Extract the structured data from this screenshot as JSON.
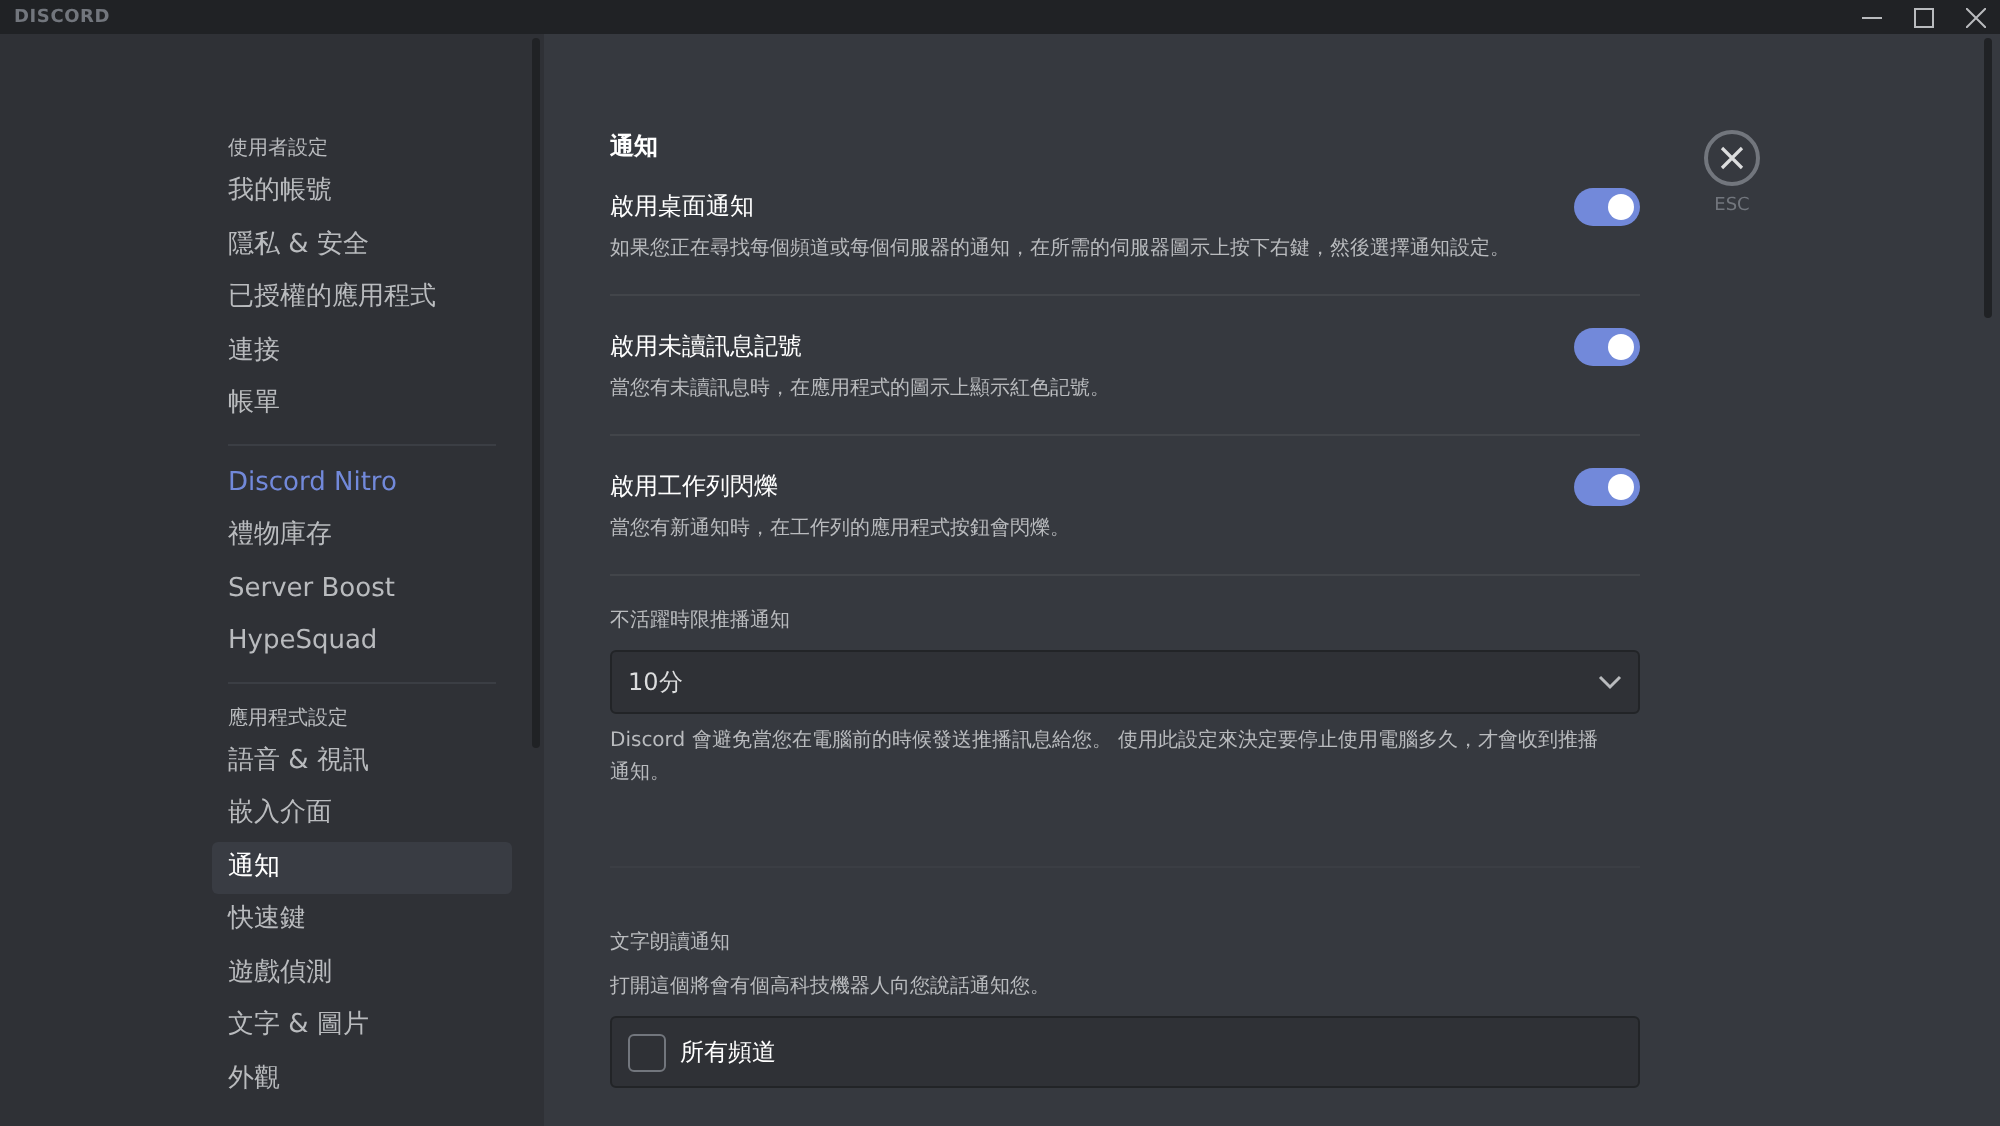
{
  "title_bar": {
    "logo": "DISCORD"
  },
  "sidebar": {
    "sections": [
      {
        "header": "使用者設定",
        "items": [
          {
            "label": "我的帳號",
            "selected": false,
            "kind": "normal"
          },
          {
            "label": "隱私 & 安全",
            "selected": false,
            "kind": "normal"
          },
          {
            "label": "已授權的應用程式",
            "selected": false,
            "kind": "normal"
          },
          {
            "label": "連接",
            "selected": false,
            "kind": "normal"
          },
          {
            "label": "帳單",
            "selected": false,
            "kind": "normal"
          }
        ]
      },
      {
        "items": [
          {
            "label": "Discord Nitro",
            "selected": false,
            "kind": "accent"
          },
          {
            "label": "禮物庫存",
            "selected": false,
            "kind": "normal"
          },
          {
            "label": "Server Boost",
            "selected": false,
            "kind": "normal"
          },
          {
            "label": "HypeSquad",
            "selected": false,
            "kind": "normal"
          }
        ]
      },
      {
        "header": "應用程式設定",
        "items": [
          {
            "label": "語音 & 視訊",
            "selected": false,
            "kind": "normal"
          },
          {
            "label": "嵌入介面",
            "selected": false,
            "kind": "normal"
          },
          {
            "label": "通知",
            "selected": true,
            "kind": "normal"
          },
          {
            "label": "快速鍵",
            "selected": false,
            "kind": "normal"
          },
          {
            "label": "遊戲偵測",
            "selected": false,
            "kind": "normal"
          },
          {
            "label": "文字 & 圖片",
            "selected": false,
            "kind": "normal"
          },
          {
            "label": "外觀",
            "selected": false,
            "kind": "normal"
          }
        ]
      }
    ]
  },
  "content": {
    "title": "通知",
    "toggles": [
      {
        "label": "啟用桌面通知",
        "description": "如果您正在尋找每個頻道或每個伺服器的通知，在所需的伺服器圖示上按下右鍵，然後選擇通知設定。",
        "on": true
      },
      {
        "label": "啟用未讀訊息記號",
        "description": "當您有未讀訊息時，在應用程式的圖示上顯示紅色記號。",
        "on": true
      },
      {
        "label": "啟用工作列閃爍",
        "description": "當您有新通知時，在工作列的應用程式按鈕會閃爍。",
        "on": true
      }
    ],
    "push_timeout": {
      "label": "不活躍時限推播通知",
      "value": "10分",
      "description": "Discord 會避免當您在電腦前的時候發送推播訊息給您。 使用此設定來決定要停止使用電腦多久，才會收到推播通知。"
    },
    "tts": {
      "label": "文字朗讀通知",
      "description": "打開這個將會有個高科技機器人向您說話通知您。",
      "options": [
        {
          "label": "所有頻道",
          "checked": false
        }
      ]
    }
  },
  "close": {
    "label": "ESC"
  }
}
